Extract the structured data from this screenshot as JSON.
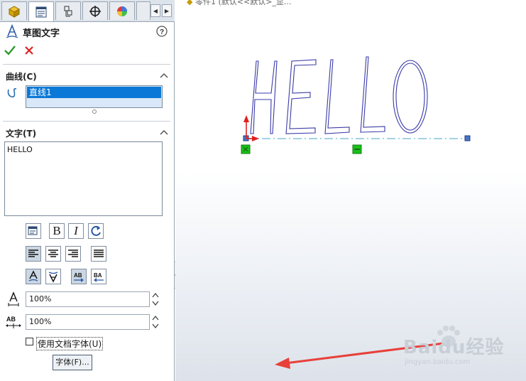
{
  "panel": {
    "title": "草图文字",
    "ok_icon": "check-icon",
    "cancel_icon": "x-icon",
    "sections": {
      "curve": {
        "label": "曲线(C)",
        "items": [
          "直线1"
        ]
      },
      "text": {
        "label": "文字(T)",
        "value": "HELLO"
      }
    },
    "width_percent": "100%",
    "spacing_percent": "100%",
    "use_doc_font_label": "使用文档字体(U)",
    "font_button_label": "字体(F)..."
  },
  "canvas": {
    "sketch_text": "HELLO",
    "top_text": "零件1 (默认<<默认>_显..."
  },
  "watermark": {
    "brand": "Baidu经验",
    "sub": "jingyan.baidu.com"
  },
  "colors": {
    "accent": "#0a78d7",
    "sketch_blue": "#3a3aa8",
    "centerline": "#6bb7d8",
    "origin_red": "#e02020",
    "relation_green": "#19c019",
    "arrow_red": "#e8403a"
  }
}
